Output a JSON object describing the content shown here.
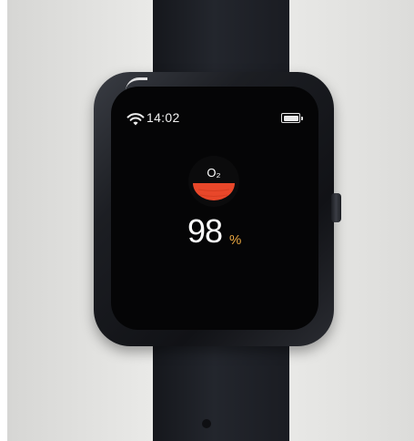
{
  "status_bar": {
    "time": "14:02",
    "wifi_icon": "wifi-icon",
    "battery_icon": "battery-full-icon",
    "battery_level": 1.0
  },
  "spo2": {
    "icon": "blood-oxygen-icon",
    "icon_label": "O₂",
    "value": "98",
    "unit": "%",
    "colors": {
      "drop": "#e8472a",
      "unit": "#e9a640",
      "value": "#ffffff",
      "screen": "#050506"
    }
  }
}
